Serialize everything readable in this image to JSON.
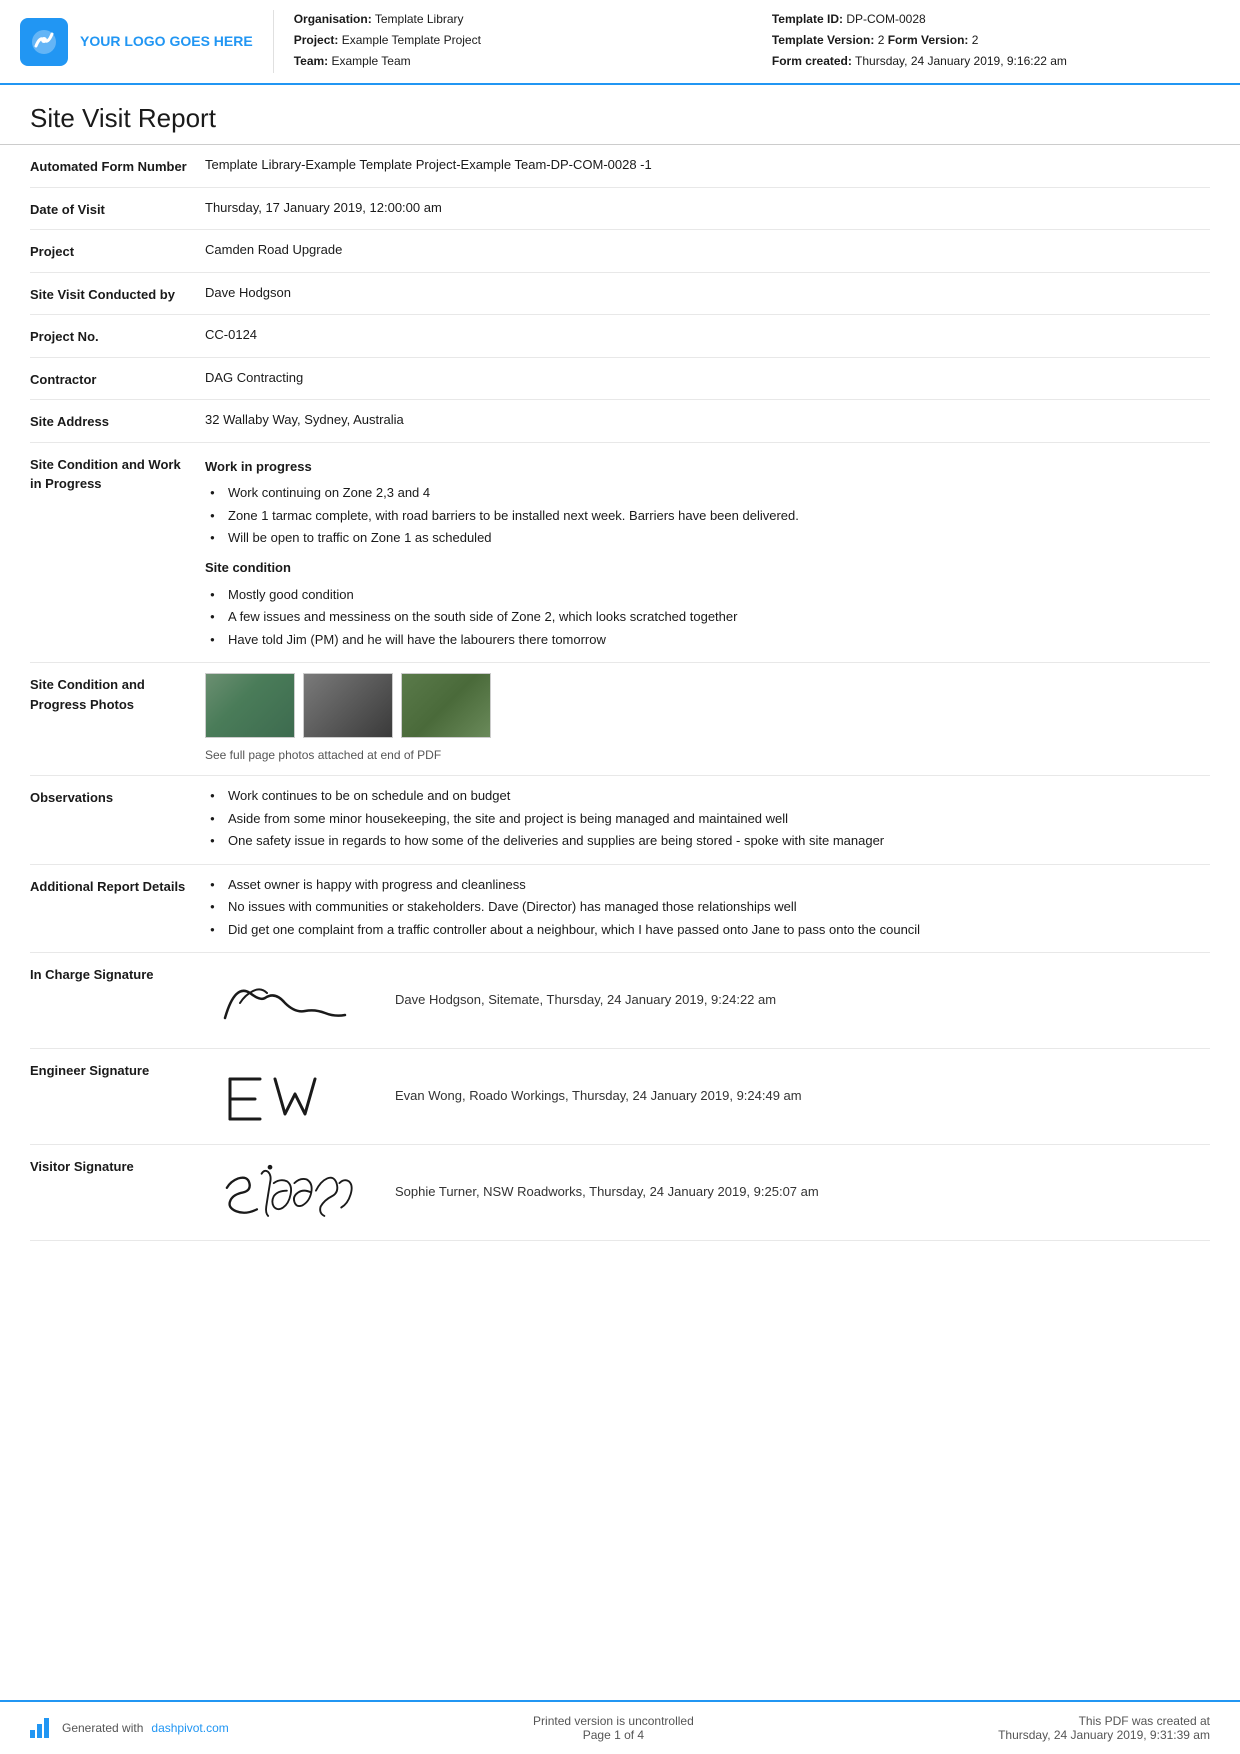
{
  "header": {
    "logo_text": "YOUR LOGO GOES HERE",
    "org_label": "Organisation:",
    "org_value": "Template Library",
    "project_label": "Project:",
    "project_value": "Example Template Project",
    "team_label": "Team:",
    "team_value": "Example Team",
    "template_id_label": "Template ID:",
    "template_id_value": "DP-COM-0028",
    "template_version_label": "Template Version:",
    "template_version_value": "2",
    "form_version_label": "Form Version:",
    "form_version_value": "2",
    "form_created_label": "Form created:",
    "form_created_value": "Thursday, 24 January 2019, 9:16:22 am"
  },
  "page_title": "Site Visit Report",
  "fields": {
    "automated_form_number_label": "Automated Form Number",
    "automated_form_number_value": "Template Library-Example Template Project-Example Team-DP-COM-0028   -1",
    "date_of_visit_label": "Date of Visit",
    "date_of_visit_value": "Thursday, 17 January 2019, 12:00:00 am",
    "project_label": "Project",
    "project_value": "Camden Road Upgrade",
    "site_visit_conducted_label": "Site Visit Conducted by",
    "site_visit_conducted_value": "Dave Hodgson",
    "project_no_label": "Project No.",
    "project_no_value": "CC-0124",
    "contractor_label": "Contractor",
    "contractor_value": "DAG Contracting",
    "site_address_label": "Site Address",
    "site_address_value": "32 Wallaby Way, Sydney, Australia",
    "site_condition_label": "Site Condition and Work in Progress",
    "work_in_progress_heading": "Work in progress",
    "work_items": [
      "Work continuing on Zone 2,3 and 4",
      "Zone 1 tarmac complete, with road barriers to be installed next week. Barriers have been delivered.",
      "Will be open to traffic on Zone 1 as scheduled"
    ],
    "site_condition_heading": "Site condition",
    "site_condition_items": [
      "Mostly good condition",
      "A few issues and messiness on the south side of Zone 2, which looks scratched together",
      "Have told Jim (PM) and he will have the labourers there tomorrow"
    ],
    "photos_label": "Site Condition and Progress Photos",
    "photos_caption": "See full page photos attached at end of PDF",
    "observations_label": "Observations",
    "observations_items": [
      "Work continues to be on schedule and on budget",
      "Aside from some minor housekeeping, the site and project is being managed and maintained well",
      "One safety issue in regards to how some of the deliveries and supplies are being stored - spoke with site manager"
    ],
    "additional_report_label": "Additional Report Details",
    "additional_report_items": [
      "Asset owner is happy with progress and cleanliness",
      "No issues with communities or stakeholders. Dave (Director) has managed those relationships well",
      "Did get one complaint from a traffic controller about a neighbour, which I have passed onto Jane to pass onto the council"
    ],
    "in_charge_label": "In Charge Signature",
    "in_charge_sig_text": "Dave Hodgson, Sitemate, Thursday, 24 January 2019, 9:24:22 am",
    "engineer_label": "Engineer Signature",
    "engineer_sig_text": "Evan Wong, Roado Workings, Thursday, 24 January 2019, 9:24:49 am",
    "visitor_label": "Visitor Signature",
    "visitor_sig_text": "Sophie Turner, NSW Roadworks, Thursday, 24 January 2019, 9:25:07 am"
  },
  "footer": {
    "generated_text": "Generated with",
    "generated_link": "dashpivot.com",
    "printed_text": "Printed version is uncontrolled",
    "page_text": "Page 1 of 4",
    "pdf_created_label": "This PDF was created at",
    "pdf_created_value": "Thursday, 24 January 2019, 9:31:39 am"
  }
}
